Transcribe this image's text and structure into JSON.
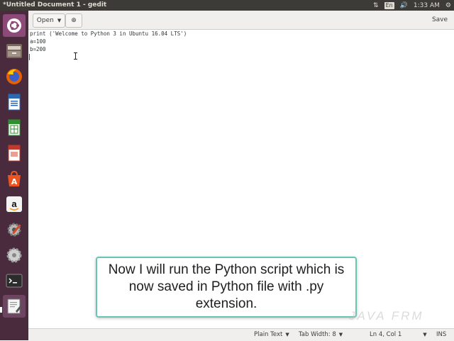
{
  "top_panel": {
    "window_title": "*Untitled Document 1 - gedit",
    "tray": {
      "network_glyph": "⇅",
      "language": "En",
      "volume_glyph": "🔊",
      "time": "1:33 AM",
      "settings_glyph": "⚙"
    }
  },
  "launcher": {
    "items": [
      "ubuntu-dash",
      "files",
      "firefox",
      "libreoffice-writer",
      "libreoffice-calc",
      "libreoffice-impress",
      "ubuntu-software",
      "amazon",
      "system-settings",
      "software-updater",
      "terminal",
      "text-editor"
    ]
  },
  "toolbar": {
    "open_label": "Open",
    "open_arrow": "▼",
    "new_glyph": "⊕",
    "save_label": "Save"
  },
  "editor": {
    "lines": [
      "print ('Welcome to Python 3 in Ubuntu 16.04 LTS')",
      "a=100",
      "b=200"
    ]
  },
  "statusbar": {
    "language": "Plain Text",
    "tab_width": "Tab Width: 8",
    "position": "Ln 4, Col 1",
    "mode": "INS"
  },
  "caption": {
    "text": "Now I will run the Python script which is now saved in Python file with .py extension."
  },
  "watermark": "JAVA FRM",
  "colors": {
    "panel": "#3c3b37",
    "launcher": "#4a2b3d",
    "caption_border": "#68c5b4"
  }
}
